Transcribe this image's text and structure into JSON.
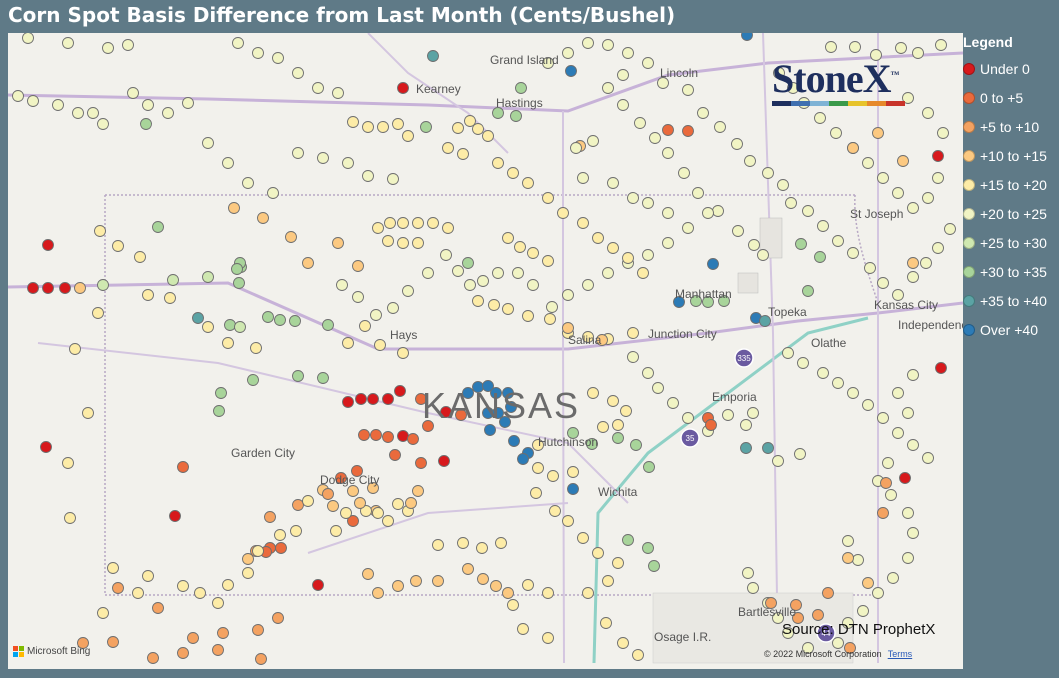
{
  "title": "Corn Spot Basis Difference from Last Month (Cents/Bushel)",
  "legend": {
    "title": "Legend",
    "items": [
      {
        "label": "Under 0",
        "color": "#d7191c"
      },
      {
        "label": "0 to +5",
        "color": "#ea6a3c"
      },
      {
        "label": "+5 to +10",
        "color": "#f4a261"
      },
      {
        "label": "+10 to +15",
        "color": "#fcc981"
      },
      {
        "label": "+15 to +20",
        "color": "#fdeca7"
      },
      {
        "label": "+20 to +25",
        "color": "#f1f4c4"
      },
      {
        "label": "+25 to +30",
        "color": "#cfe8b0"
      },
      {
        "label": "+30 to +35",
        "color": "#a8d49a"
      },
      {
        "label": "+35 to +40",
        "color": "#5ba3a4"
      },
      {
        "label": "Over +40",
        "color": "#2c7bb6"
      }
    ]
  },
  "map": {
    "state_label": "KANSAS",
    "places": [
      "Grand Island",
      "Kearney",
      "Hastings",
      "Lincoln",
      "St Joseph",
      "Manhattan",
      "Topeka",
      "Kansas City",
      "Independence",
      "Olathe",
      "Junction City",
      "Salina",
      "Hays",
      "Emporia",
      "Hutchinson",
      "Garden City",
      "Dodge City",
      "Wichita",
      "Bartlesville",
      "Osage I.R."
    ],
    "highways": [
      "335",
      "35",
      "44"
    ]
  },
  "logo": {
    "text": "StoneX",
    "tm": "™",
    "stripe_colors": [
      "#1e2f5e",
      "#3f6fb0",
      "#7fb3d5",
      "#3a9a4a",
      "#e7c32a",
      "#e6892b",
      "#c8342a"
    ]
  },
  "source": "Source: DTN ProphetX",
  "copyright": "© 2022 Microsoft Corporation",
  "terms": "Terms",
  "bing": "Microsoft Bing"
}
